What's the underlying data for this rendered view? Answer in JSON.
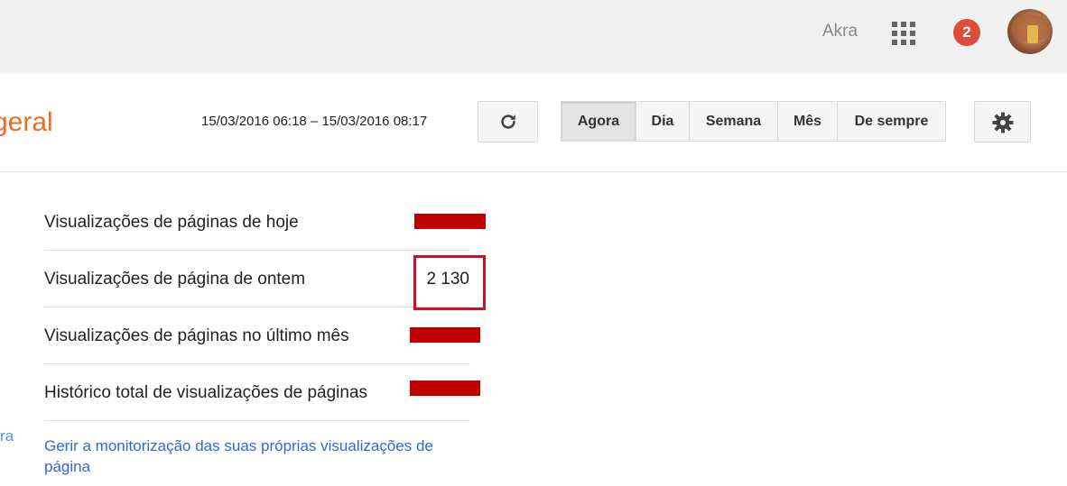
{
  "topbar": {
    "user_name": "Akra",
    "notification_count": "2"
  },
  "header": {
    "title": "geral",
    "date_range": "15/03/2016 06:18 – 15/03/2016 08:17",
    "range_options": [
      "Agora",
      "Dia",
      "Semana",
      "Mês",
      "De sempre"
    ],
    "active_range": "Agora"
  },
  "stats": [
    {
      "label": "Visualizações de páginas de hoje",
      "value": ""
    },
    {
      "label": "Visualizações de página de ontem",
      "value": "2 130"
    },
    {
      "label": "Visualizações de páginas no último mês",
      "value": ""
    },
    {
      "label": "Histórico total de visualizações de páginas",
      "value": ""
    }
  ],
  "manage_link": "Gerir a monitorização das suas próprias visualizações de página",
  "left_link_fragment": "ra",
  "colors": {
    "title_orange": "#f26c21",
    "link_blue": "#3367d6",
    "redaction_red": "#c00000",
    "badge_red": "#dd4b39"
  }
}
